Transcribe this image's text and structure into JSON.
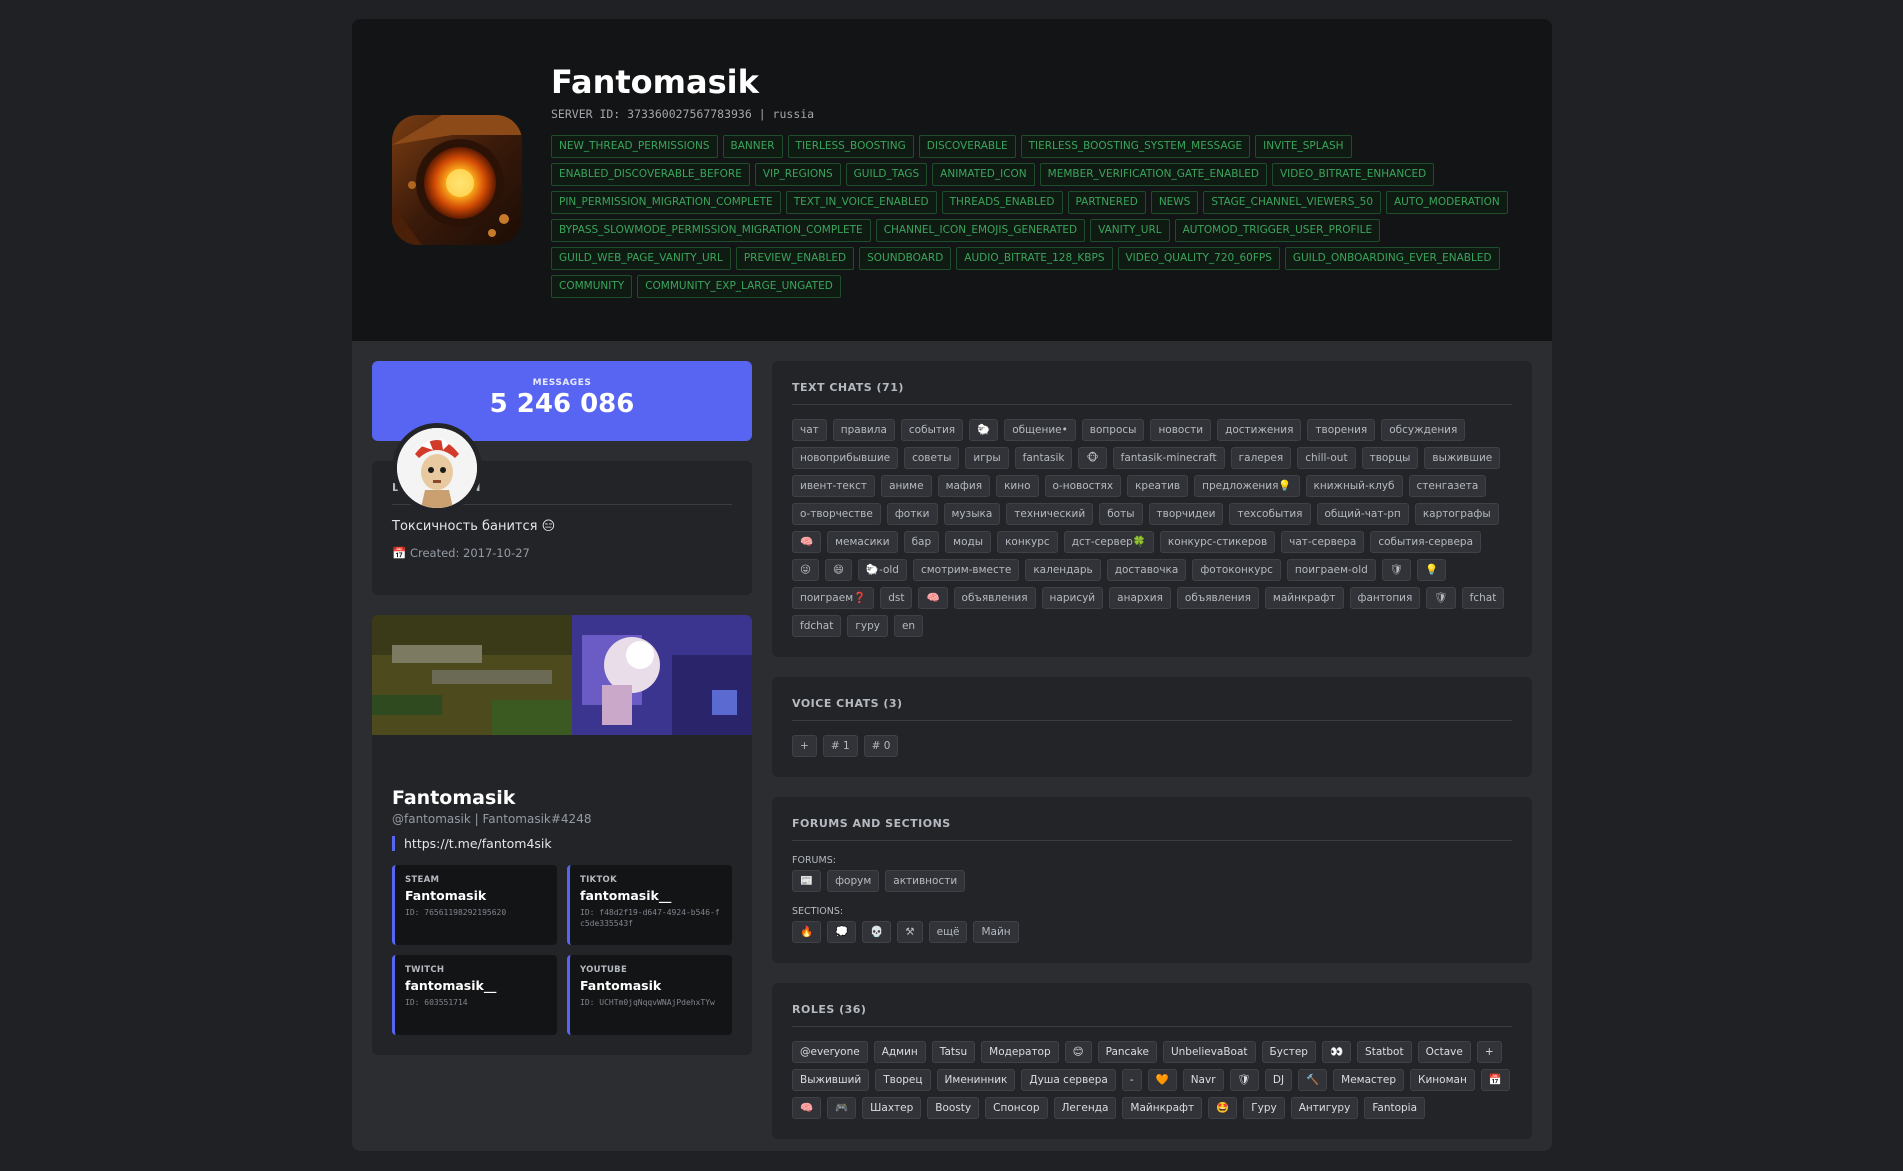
{
  "server": {
    "name": "Fantomasik",
    "id_line": "SERVER ID: 373360027567783936 | russia",
    "features": [
      "NEW_THREAD_PERMISSIONS",
      "BANNER",
      "TIERLESS_BOOSTING",
      "DISCOVERABLE",
      "TIERLESS_BOOSTING_SYSTEM_MESSAGE",
      "INVITE_SPLASH",
      "ENABLED_DISCOVERABLE_BEFORE",
      "VIP_REGIONS",
      "GUILD_TAGS",
      "ANIMATED_ICON",
      "MEMBER_VERIFICATION_GATE_ENABLED",
      "VIDEO_BITRATE_ENHANCED",
      "PIN_PERMISSION_MIGRATION_COMPLETE",
      "TEXT_IN_VOICE_ENABLED",
      "THREADS_ENABLED",
      "PARTNERED",
      "NEWS",
      "STAGE_CHANNEL_VIEWERS_50",
      "AUTO_MODERATION",
      "BYPASS_SLOWMODE_PERMISSION_MIGRATION_COMPLETE",
      "CHANNEL_ICON_EMOJIS_GENERATED",
      "VANITY_URL",
      "AUTOMOD_TRIGGER_USER_PROFILE",
      "GUILD_WEB_PAGE_VANITY_URL",
      "PREVIEW_ENABLED",
      "SOUNDBOARD",
      "AUDIO_BITRATE_128_KBPS",
      "VIDEO_QUALITY_720_60FPS",
      "GUILD_ONBOARDING_EVER_ENABLED",
      "COMMUNITY",
      "COMMUNITY_EXP_LARGE_UNGATED"
    ]
  },
  "stats": {
    "label": "MESSAGES",
    "value": "5 246 086"
  },
  "description": {
    "title": "DESCRIPTION",
    "text": "Токсичность банится 😑",
    "created": "📅 Created: 2017-10-27"
  },
  "profile": {
    "name": "Fantomasik",
    "handle": "@fantomasik | Fantomasik#4248",
    "link": "https://t.me/fantom4sik",
    "accounts": [
      {
        "label": "STEAM",
        "name": "Fantomasik",
        "id": "ID: 76561198292195620"
      },
      {
        "label": "TIKTOK",
        "name": "fantomasik__",
        "id": "ID: f48d2f19-d647-4924-b546-fc5de335543f"
      },
      {
        "label": "TWITCH",
        "name": "fantomasik__",
        "id": "ID: 603551714"
      },
      {
        "label": "YOUTUBE",
        "name": "Fantomasik",
        "id": "ID: UCHTm0jqNqqvWNAjPdehxTYw"
      }
    ]
  },
  "text_chats": {
    "title": "TEXT CHATS (71)",
    "items": [
      "чат",
      "правила",
      "события",
      "🐑",
      "общение•",
      "вопросы",
      "новости",
      "достижения",
      "творения",
      "обсуждения",
      "новоприбывшие",
      "советы",
      "игры",
      "fantasik",
      "🐵",
      "fantasik-minecraft",
      "галерея",
      "chill-out",
      "творцы",
      "выжившие",
      "ивент-текст",
      "аниме",
      "мафия",
      "кино",
      "о-новостях",
      "креатив",
      "предложения💡",
      "книжный-клуб",
      "стенгазета",
      "о-творчестве",
      "фотки",
      "музыка",
      "технический",
      "боты",
      "творчидеи",
      "техсобытия",
      "общий-чат-рп",
      "картографы",
      "🧠",
      "мемасики",
      "бар",
      "моды",
      "конкурс",
      "дст-сервер🍀",
      "конкурс-стикеров",
      "чат-сервера",
      "события-сервера",
      "😜",
      "😄",
      "🐑-old",
      "смотрим-вместе",
      "календарь",
      "доставочка",
      "фотоконкурс",
      "поиграем-old",
      "🛡",
      "💡",
      "поиграем❓",
      "dst",
      "🧠",
      "объявления",
      "нарисуй",
      "анархия",
      "объявления",
      "майнкрафт",
      "фантопия",
      "🛡",
      "fchat",
      "fdchat",
      "гуру",
      "en"
    ]
  },
  "voice_chats": {
    "title": "VOICE CHATS (3)",
    "items": [
      "+",
      "# 1",
      "# 0"
    ]
  },
  "forums": {
    "title": "FORUMS AND SECTIONS",
    "forums_label": "FORUMS:",
    "forums": [
      "📰",
      "форум",
      "активности"
    ],
    "sections_label": "SECTIONS:",
    "sections": [
      "🔥",
      "💭",
      "💀",
      "⚒",
      "ещё",
      "Майн"
    ]
  },
  "roles": {
    "title": "ROLES (36)",
    "items": [
      "@everyone",
      "Админ",
      "Tatsu",
      "Модератор",
      "😊",
      "Pancake",
      "UnbelievaBoat",
      "Бустер",
      "👀",
      "Statbot",
      "Octave",
      "+",
      "Выживший",
      "Творец",
      "Именинник",
      "Душа сервера",
      "-",
      "🧡",
      "Navr",
      "🛡",
      "DJ",
      "🔨",
      "Мемастер",
      "Киноман",
      "📅",
      "🧠",
      "🎮",
      "Шахтер",
      "Boosty",
      "Спонсор",
      "Легенда",
      "Майнкрафт",
      "🤩",
      "Гуру",
      "Антигуру",
      "Fantopia"
    ]
  }
}
